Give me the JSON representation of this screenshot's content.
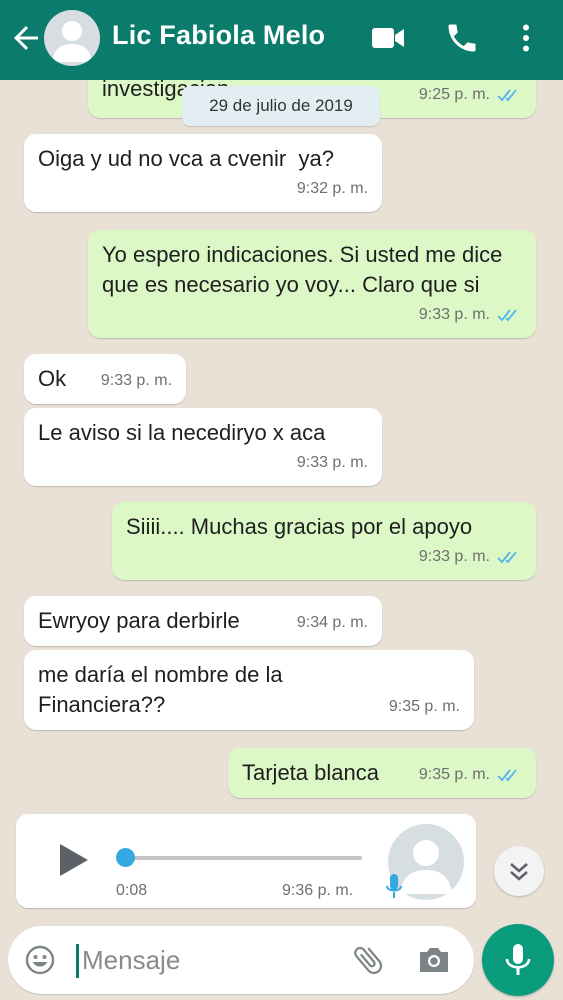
{
  "header": {
    "contact_name": "Lic Fabiola Melo",
    "bg_color": "#0b7b6b"
  },
  "chat": {
    "date_chip": "29 de julio de 2019",
    "messages": [
      {
        "direction": "out",
        "text": "investigacion",
        "time": "9:25 p. m.",
        "read": true
      },
      {
        "direction": "in",
        "text": "Oiga y ud no vca a cvenir  ya?",
        "time": "9:32 p. m."
      },
      {
        "direction": "out",
        "text": "Yo espero indicaciones. Si usted me dice que es necesario yo voy... Claro que si",
        "time": "9:33 p. m.",
        "read": true
      },
      {
        "direction": "in",
        "text": "Ok",
        "time": "9:33 p. m."
      },
      {
        "direction": "in",
        "text": "Le aviso si la necediryo x aca",
        "time": "9:33 p. m."
      },
      {
        "direction": "out",
        "text": "Siiii.... Muchas gracias por el apoyo",
        "time": "9:33 p. m.",
        "read": true
      },
      {
        "direction": "in",
        "text": "Ewryoy para derbirle",
        "time": "9:34 p. m."
      },
      {
        "direction": "in",
        "text": "me daría el nombre de la Financiera??",
        "time": "9:35 p. m."
      },
      {
        "direction": "out",
        "text": "Tarjeta blanca",
        "time": "9:35 p. m.",
        "read": true
      }
    ],
    "voice_note": {
      "duration": "0:08",
      "time": "9:36 p. m.",
      "progress": 0
    }
  },
  "composer": {
    "placeholder": "Mensaje"
  },
  "colors": {
    "incoming": "#ffffff",
    "outgoing": "#dcf8c6",
    "read_ticks": "#4fb6ec",
    "accent": "#0b9c7e"
  }
}
